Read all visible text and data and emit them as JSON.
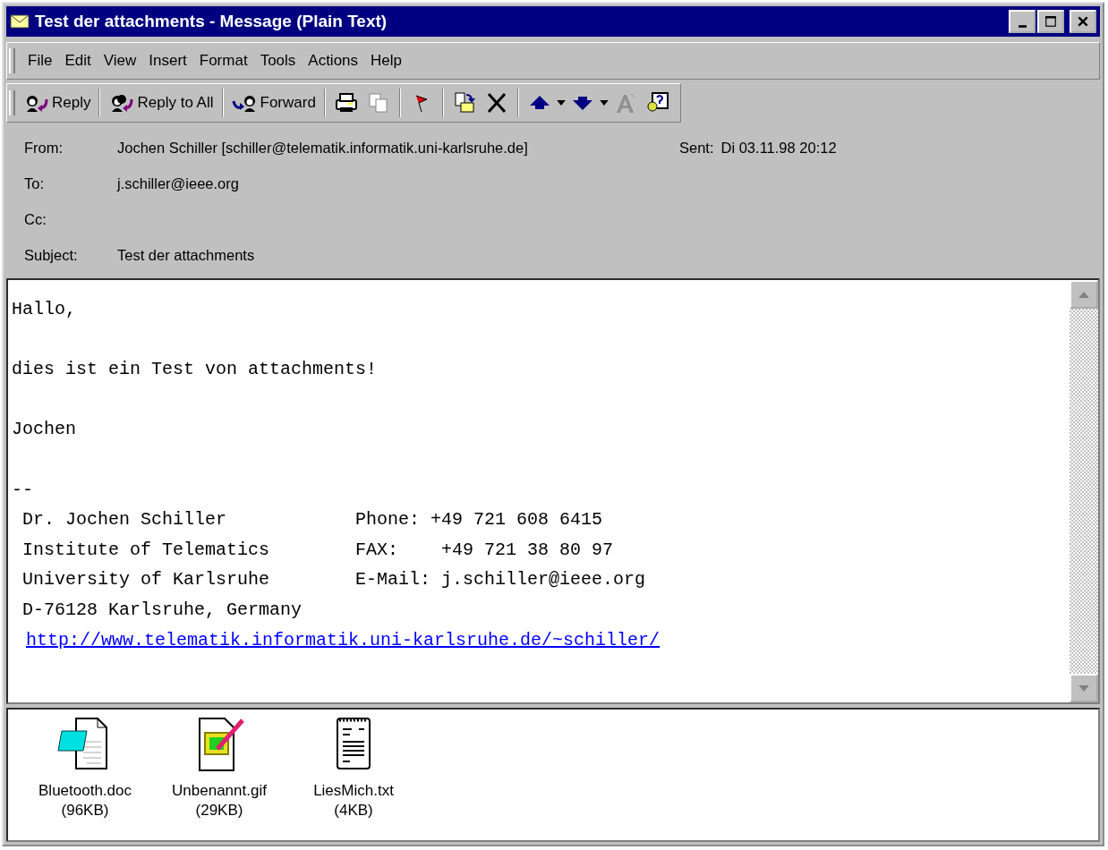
{
  "window": {
    "title": "Test der attachments - Message (Plain Text)"
  },
  "menu": [
    {
      "label": "File"
    },
    {
      "label": "Edit"
    },
    {
      "label": "View"
    },
    {
      "label": "Insert"
    },
    {
      "label": "Format"
    },
    {
      "label": "Tools"
    },
    {
      "label": "Actions"
    },
    {
      "label": "Help"
    }
  ],
  "toolbar": [
    [
      {
        "kind": "reply",
        "label": "Reply"
      }
    ],
    [
      {
        "kind": "replyall",
        "label": "Reply to All"
      }
    ],
    [
      {
        "kind": "forward",
        "label": "Forward"
      }
    ],
    [
      {
        "kind": "print"
      },
      {
        "kind": "copy"
      }
    ],
    [
      {
        "kind": "flag"
      }
    ],
    [
      {
        "kind": "move"
      },
      {
        "kind": "delete"
      }
    ],
    [
      {
        "kind": "previous"
      },
      {
        "kind": "dropdown"
      },
      {
        "kind": "next"
      },
      {
        "kind": "dropdown"
      },
      {
        "kind": "font",
        "disabled": true
      },
      {
        "kind": "help"
      }
    ]
  ],
  "header": {
    "from_label": "From:",
    "from": "Jochen Schiller [schiller@telematik.informatik.uni-karlsruhe.de]",
    "sent_label": "Sent:",
    "sent": "Di 03.11.98 20:12",
    "to_label": "To:",
    "to": "j.schiller@ieee.org",
    "cc_label": "Cc:",
    "subject_label": "Subject:",
    "subject": "Test der attachments"
  },
  "body": [
    {
      "kind": "text",
      "text": "Hallo,"
    },
    {
      "kind": "blank"
    },
    {
      "kind": "text",
      "text": "dies ist ein Test von attachments!"
    },
    {
      "kind": "blank"
    },
    {
      "kind": "text",
      "text": "Jochen"
    },
    {
      "kind": "blank"
    },
    {
      "kind": "text",
      "text": "--"
    },
    {
      "kind": "text",
      "text": " Dr. Jochen Schiller            Phone: +49 721 608 6415"
    },
    {
      "kind": "text",
      "text": " Institute of Telematics        FAX:    +49 721 38 80 97"
    },
    {
      "kind": "text",
      "text": " University of Karlsruhe        E-Mail: j.schiller@ieee.org"
    },
    {
      "kind": "text",
      "text": " D-76128 Karlsruhe, Germany"
    },
    {
      "kind": "link",
      "text": "http://www.telematik.informatik.uni-karlsruhe.de/~schiller/"
    }
  ],
  "attachments": [
    {
      "kind": "doc",
      "name": "Bluetooth.doc",
      "size": "(96KB)"
    },
    {
      "kind": "gif",
      "name": "Unbenannt.gif",
      "size": "(29KB)"
    },
    {
      "kind": "txt",
      "name": "LiesMich.txt",
      "size": "(4KB)"
    }
  ]
}
